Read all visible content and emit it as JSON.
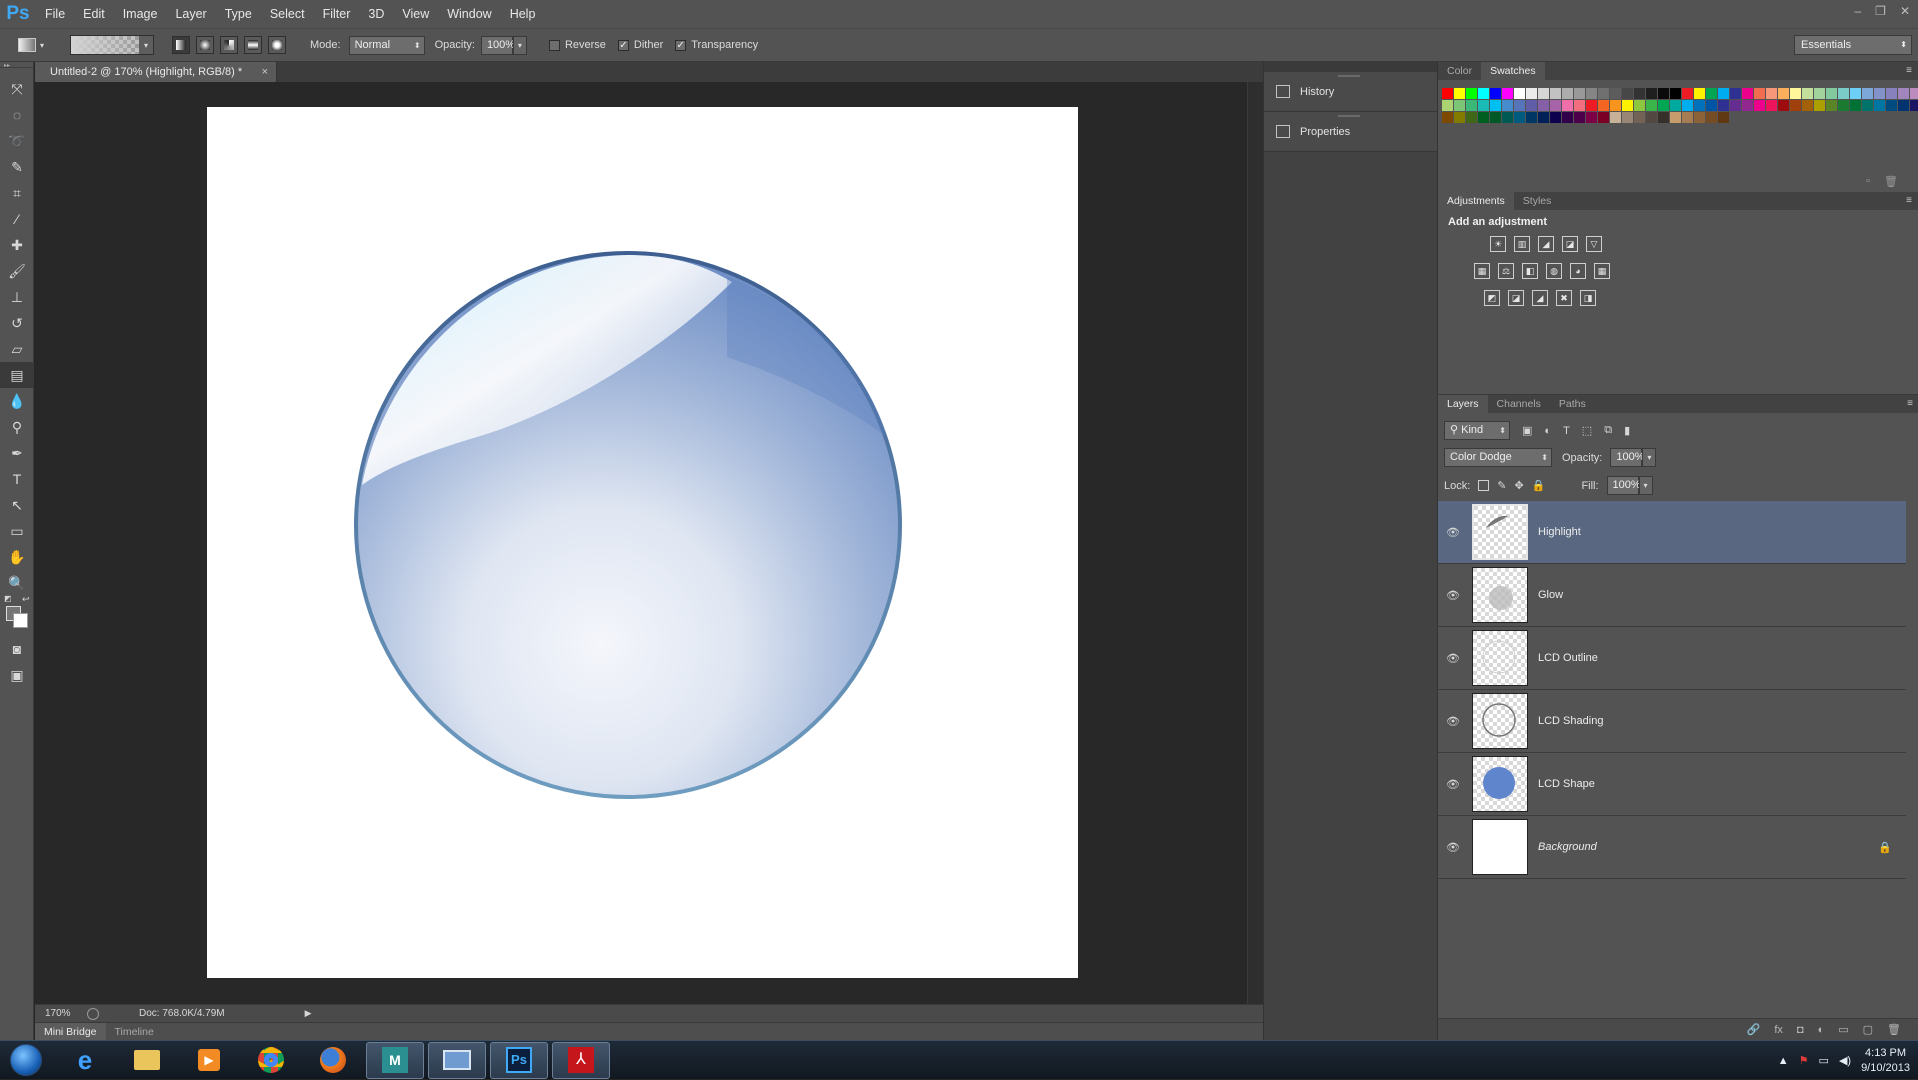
{
  "app": {
    "logo": "Ps"
  },
  "menu": [
    "File",
    "Edit",
    "Image",
    "Layer",
    "Type",
    "Select",
    "Filter",
    "3D",
    "View",
    "Window",
    "Help"
  ],
  "window_controls": {
    "minimize": "–",
    "restore": "❐",
    "close": "✕"
  },
  "options": {
    "mode_label": "Mode:",
    "mode_value": "Normal",
    "opacity_label": "Opacity:",
    "opacity_value": "100%",
    "reverse_label": "Reverse",
    "reverse_checked": "",
    "dither_label": "Dither",
    "dither_checked": "✓",
    "transparency_label": "Transparency",
    "transparency_checked": "✓",
    "workspace": "Essentials"
  },
  "document": {
    "tab_title": "Untitled-2 @ 170% (Highlight, RGB/8) *",
    "close": "×"
  },
  "status": {
    "zoom": "170%",
    "doc_info": "Doc: 768.0K/4.79M"
  },
  "bottom_tabs": [
    "Mini Bridge",
    "Timeline"
  ],
  "dock": {
    "items": [
      "History",
      "Properties"
    ]
  },
  "color_panel": {
    "tabs": [
      "Color",
      "Swatches"
    ],
    "active": "Swatches"
  },
  "swatches": [
    "#ff0000",
    "#ffff00",
    "#00ff00",
    "#00ffff",
    "#0000ff",
    "#ff00ff",
    "#ffffff",
    "#ebebeb",
    "#d6d6d6",
    "#c2c2c2",
    "#adadad",
    "#999999",
    "#858585",
    "#707070",
    "#5c5c5c",
    "#474747",
    "#333333",
    "#1f1f1f",
    "#0a0a0a",
    "#000000",
    "#ed1c24",
    "#fff200",
    "#00a651",
    "#00aeef",
    "#2e3192",
    "#ec008c",
    "#f26c4f",
    "#f7977a",
    "#fbaf5d",
    "#fff79a",
    "#c4df9b",
    "#a3d39c",
    "#82ca9d",
    "#7accc8",
    "#6dcff6",
    "#7da7d9",
    "#8393ca",
    "#8781bd",
    "#a186be",
    "#bd8cbf",
    "#f49ac1",
    "#f5989d",
    "#f26d7d",
    "#f68e56",
    "#fdc689",
    "#fff467",
    "#acd372",
    "#7cc576",
    "#3bb878",
    "#1abbb4",
    "#00bff3",
    "#448ccb",
    "#5574b9",
    "#605ca8",
    "#8560a8",
    "#a864a8",
    "#f06eaa",
    "#f26d7d",
    "#ed1c24",
    "#f26522",
    "#f7941d",
    "#fff200",
    "#8dc73f",
    "#39b54a",
    "#00a651",
    "#00a99d",
    "#00aeef",
    "#0072bc",
    "#0054a6",
    "#2e3192",
    "#662d91",
    "#92278f",
    "#ec008c",
    "#ed145b",
    "#9e0b0f",
    "#a0410d",
    "#a36209",
    "#aba000",
    "#598527",
    "#1a7b30",
    "#007236",
    "#00746b",
    "#0076a3",
    "#004b80",
    "#003471",
    "#1b1464",
    "#440e62",
    "#630460",
    "#9e005d",
    "#9e0039",
    "#790000",
    "#7b2e00",
    "#7d4900",
    "#827b00",
    "#406618",
    "#005e20",
    "#005826",
    "#005952",
    "#005b7f",
    "#003663",
    "#002157",
    "#0d004c",
    "#32004b",
    "#4b0049",
    "#7b0046",
    "#7a0026",
    "#c7b299",
    "#998675",
    "#736357",
    "#534741",
    "#37302a",
    "#c69c6d",
    "#a67c52",
    "#8c6239",
    "#754c24",
    "#603913"
  ],
  "adjustments": {
    "tabs": [
      "Adjustments",
      "Styles"
    ],
    "title": "Add an adjustment",
    "row1": [
      "☀",
      "▥",
      "◢",
      "◪",
      "▽"
    ],
    "row2": [
      "▦",
      "⚖",
      "◧",
      "◍",
      "◕",
      "▦"
    ],
    "row3": [
      "◩",
      "◪",
      "◢",
      "✖",
      "◨"
    ]
  },
  "layers_panel": {
    "tabs": [
      "Layers",
      "Channels",
      "Paths"
    ],
    "filter_label": "Kind",
    "blend_mode": "Color Dodge",
    "opacity_label": "Opacity:",
    "opacity_value": "100%",
    "lock_label": "Lock:",
    "fill_label": "Fill:",
    "fill_value": "100%",
    "layers": [
      {
        "name": "Highlight",
        "selected": true
      },
      {
        "name": "Glow"
      },
      {
        "name": "LCD Outline"
      },
      {
        "name": "LCD Shading"
      },
      {
        "name": "LCD Shape"
      },
      {
        "name": "Background",
        "locked": true
      }
    ],
    "footer_icons": [
      "🔗",
      "fx",
      "◘",
      "◐",
      "▭",
      "▢",
      "🗑"
    ]
  },
  "taskbar": {
    "apps": [
      "Internet Explorer",
      "Windows Explorer",
      "Media Player",
      "Chrome",
      "Firefox",
      "Maya",
      "Remote Desktop",
      "Photoshop",
      "Acrobat"
    ],
    "time": "4:13 PM",
    "date": "9/10/2013"
  }
}
